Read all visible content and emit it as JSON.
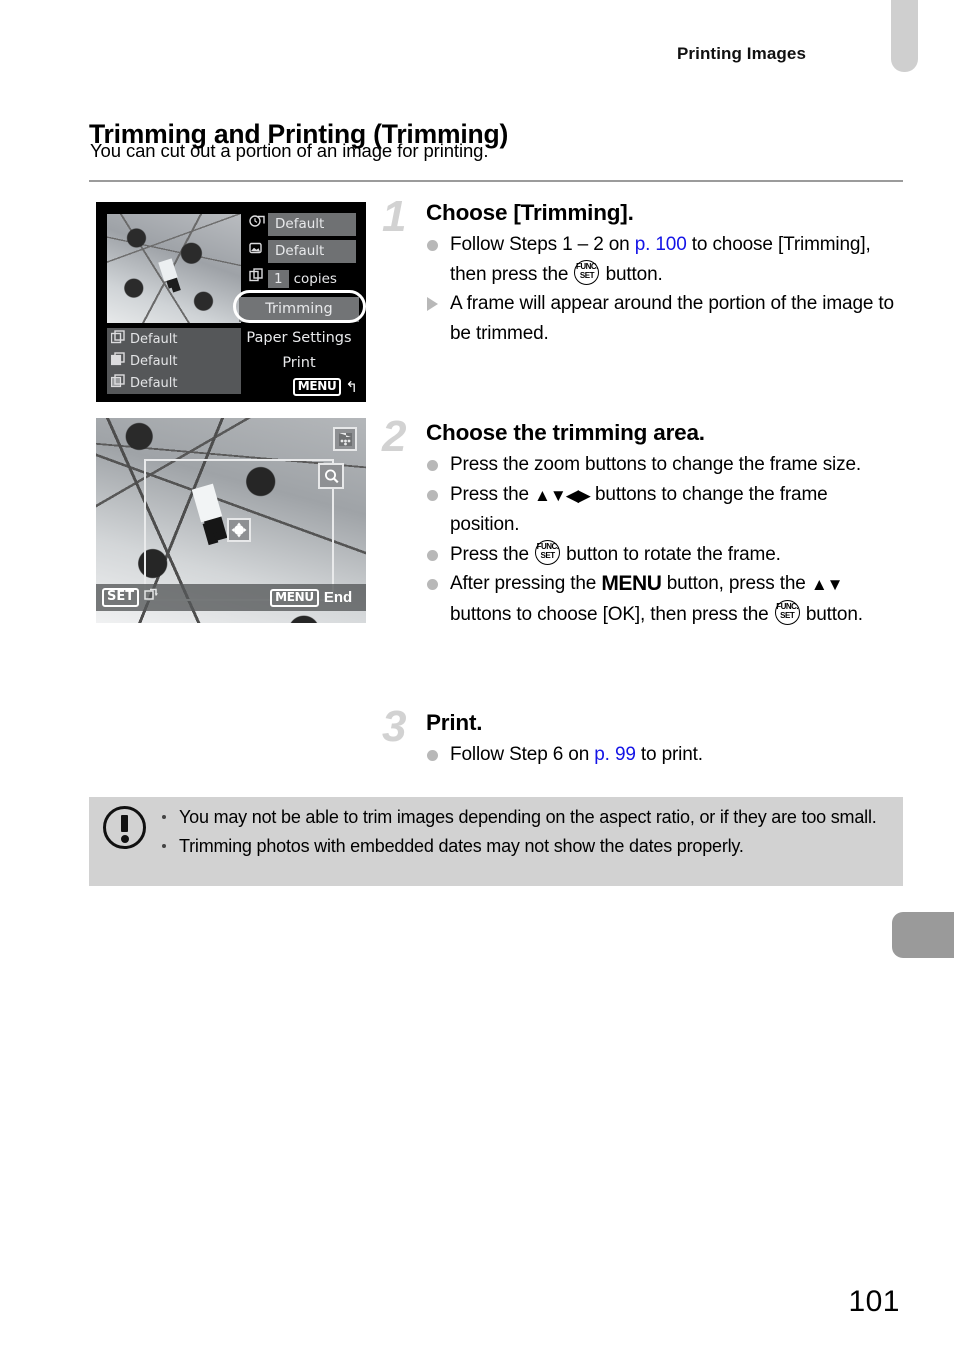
{
  "header": {
    "running_head": "Printing Images"
  },
  "section": {
    "title": "Trimming and Printing (Trimming)",
    "subtitle": "You can cut out a portion of an image for printing."
  },
  "screenshot1": {
    "left_rows": [
      {
        "icon": "print-effect-icon",
        "label": "Default"
      },
      {
        "icon": "file-number-icon",
        "label": "Default"
      },
      {
        "icon": "date-imprint-icon",
        "label": "Default"
      }
    ],
    "right_rows": [
      {
        "icon": "date-icon",
        "value": "Default"
      },
      {
        "icon": "image-icon",
        "value": "Default"
      }
    ],
    "copies": {
      "icon": "copies-icon",
      "number": "1",
      "unit": "copies"
    },
    "menu_items": [
      "Trimming",
      "Paper Settings",
      "Print"
    ],
    "highlighted_item": "Trimming",
    "menu_badge": "MENU",
    "back_arrow": "↰"
  },
  "screenshot2": {
    "icons": [
      "grid-icon",
      "magnifier-icon",
      "move-frame-icon"
    ],
    "bottom_bar": {
      "set_badge": "SET",
      "set_action_icon": "rotate-frame-icon",
      "menu_badge": "MENU",
      "menu_label": "End"
    }
  },
  "steps": [
    {
      "number": "1",
      "title": "Choose [Trimming].",
      "bullets": [
        {
          "marker": "dot",
          "segments": [
            {
              "t": "Follow Steps 1 – 2 on "
            },
            {
              "t": "p. 100",
              "link": true
            },
            {
              "t": " to choose [Trimming], then press the "
            },
            {
              "t": "FUNC.SET",
              "glyph": "funcset"
            },
            {
              "t": " button."
            }
          ]
        },
        {
          "marker": "triangle",
          "segments": [
            {
              "t": "A frame will appear around the portion of the image to be trimmed."
            }
          ]
        }
      ]
    },
    {
      "number": "2",
      "title": "Choose the trimming area.",
      "bullets": [
        {
          "marker": "dot",
          "segments": [
            {
              "t": "Press the zoom buttons to change the frame size."
            }
          ]
        },
        {
          "marker": "dot",
          "segments": [
            {
              "t": "Press the "
            },
            {
              "t": "▲▼◀▶",
              "glyph": "arrows"
            },
            {
              "t": " buttons to change the frame position."
            }
          ]
        },
        {
          "marker": "dot",
          "segments": [
            {
              "t": "Press the "
            },
            {
              "t": "FUNC.SET",
              "glyph": "funcset"
            },
            {
              "t": " button to rotate the frame."
            }
          ]
        },
        {
          "marker": "dot",
          "segments": [
            {
              "t": "After pressing the "
            },
            {
              "t": "MENU",
              "glyph": "menu-word"
            },
            {
              "t": " button, press the "
            },
            {
              "t": "▲▼",
              "glyph": "arrows"
            },
            {
              "t": " buttons to choose [OK], then press the "
            },
            {
              "t": "FUNC.SET",
              "glyph": "funcset"
            },
            {
              "t": " button."
            }
          ]
        }
      ]
    },
    {
      "number": "3",
      "title": "Print.",
      "bullets": [
        {
          "marker": "dot",
          "segments": [
            {
              "t": "Follow Step 6 on "
            },
            {
              "t": "p. 99",
              "link": true
            },
            {
              "t": " to print."
            }
          ]
        }
      ]
    }
  ],
  "caution": {
    "icon": "exclamation-icon",
    "items": [
      "You may not be able to trim images depending on the aspect ratio, or if they are too small.",
      "Trimming photos with embedded dates may not show the dates properly."
    ]
  },
  "footer": {
    "page_number": "101"
  },
  "colors": {
    "link": "#1414e6",
    "caution_background": "#d2d2d2",
    "step_number": "#d2d2d2",
    "bullet_marker": "#b8b8b8",
    "tab_top": "#cfcfcf",
    "tab_mid": "#9a9a9a"
  }
}
